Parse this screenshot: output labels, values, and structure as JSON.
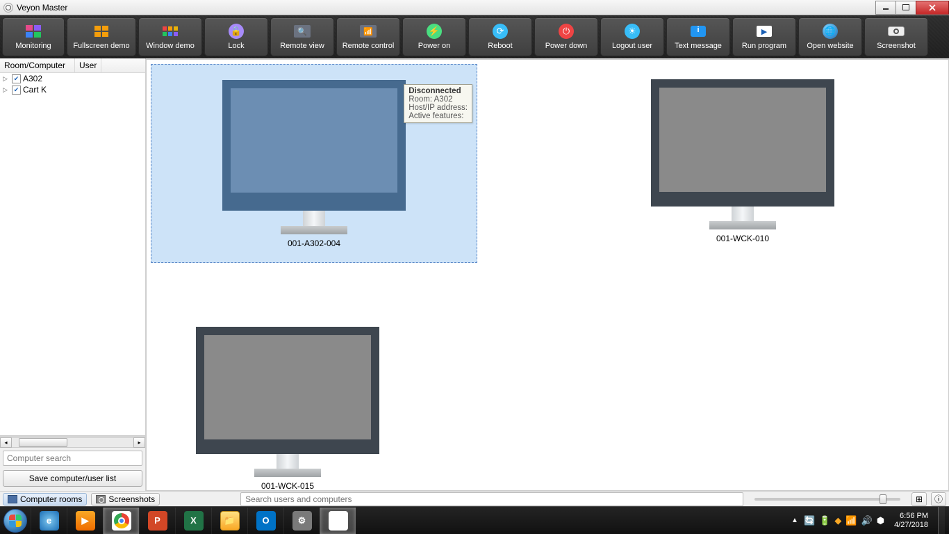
{
  "window": {
    "title": "Veyon Master"
  },
  "toolbar": [
    {
      "id": "monitoring",
      "label": "Monitoring"
    },
    {
      "id": "fullscreen-demo",
      "label": "Fullscreen demo"
    },
    {
      "id": "window-demo",
      "label": "Window demo"
    },
    {
      "id": "lock",
      "label": "Lock"
    },
    {
      "id": "remote-view",
      "label": "Remote view"
    },
    {
      "id": "remote-control",
      "label": "Remote control"
    },
    {
      "id": "power-on",
      "label": "Power on"
    },
    {
      "id": "reboot",
      "label": "Reboot"
    },
    {
      "id": "power-down",
      "label": "Power down"
    },
    {
      "id": "logout-user",
      "label": "Logout user"
    },
    {
      "id": "text-message",
      "label": "Text message"
    },
    {
      "id": "run-program",
      "label": "Run program"
    },
    {
      "id": "open-website",
      "label": "Open website"
    },
    {
      "id": "screenshot",
      "label": "Screenshot"
    }
  ],
  "tree": {
    "columns": {
      "c1": "Room/Computer",
      "c2": "User"
    },
    "items": [
      {
        "label": "A302",
        "checked": true
      },
      {
        "label": "Cart K",
        "checked": true
      }
    ]
  },
  "sidebar": {
    "search_placeholder": "Computer search",
    "save_button": "Save computer/user list"
  },
  "computers": [
    {
      "label": "001-A302-004",
      "selected": true
    },
    {
      "label": "001-WCK-010",
      "selected": false
    },
    {
      "label": "001-WCK-015",
      "selected": false
    }
  ],
  "tooltip": {
    "status": "Disconnected",
    "room_label": "Room:",
    "room_value": "A302",
    "host_label": "Host/IP address:",
    "features_label": "Active features:"
  },
  "bottom": {
    "panel_rooms": "Computer rooms",
    "panel_screens": "Screenshots",
    "search_placeholder": "Search users and computers"
  },
  "system": {
    "time": "6:56 PM",
    "date": "4/27/2018"
  }
}
